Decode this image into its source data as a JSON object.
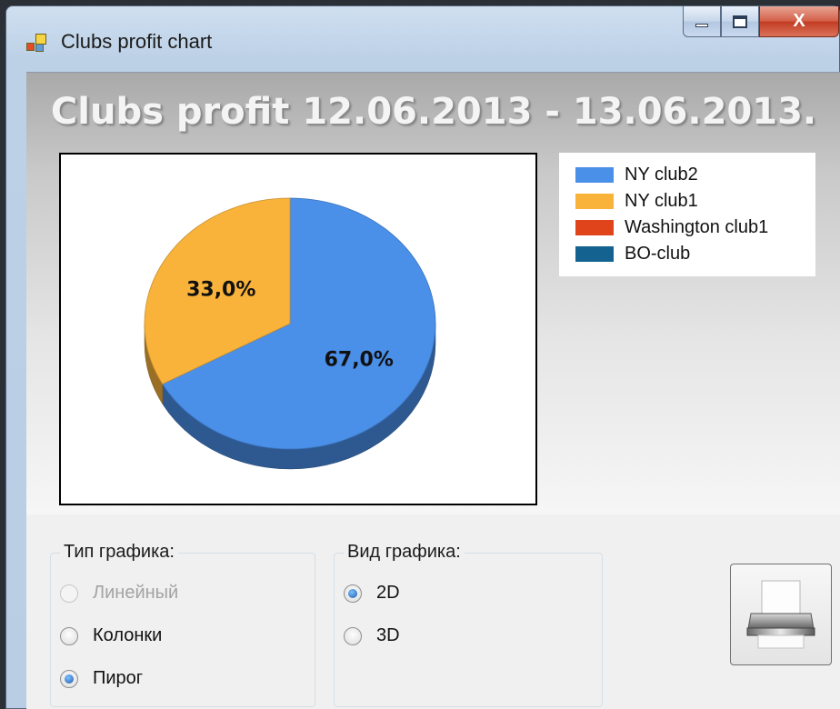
{
  "window": {
    "title": "Clubs profit chart",
    "icons": {
      "app": "app-window-icon",
      "minimize": "minimize-icon",
      "maximize": "maximize-icon",
      "close": "close-icon"
    },
    "close_glyph": "X"
  },
  "chart": {
    "title": "Clubs profit 12.06.2013 - 13.06.2013.",
    "legend": [
      {
        "label": "NY club2",
        "color": "#4a8fe8"
      },
      {
        "label": "NY club1",
        "color": "#f9b33b"
      },
      {
        "label": "Washington club1",
        "color": "#e0441a"
      },
      {
        "label": "BO-club",
        "color": "#13628f"
      }
    ]
  },
  "chart_data": {
    "type": "pie",
    "title": "Clubs profit 12.06.2013 - 13.06.2013.",
    "series": [
      {
        "name": "NY club2",
        "value": 67.0,
        "label": "67,0%",
        "color": "#4a8fe8"
      },
      {
        "name": "NY club1",
        "value": 33.0,
        "label": "33,0%",
        "color": "#f9b33b"
      },
      {
        "name": "Washington club1",
        "value": 0,
        "label": "",
        "color": "#e0441a"
      },
      {
        "name": "BO-club",
        "value": 0,
        "label": "",
        "color": "#13628f"
      }
    ],
    "style": "3D",
    "legend_position": "top-right"
  },
  "chart_type_group": {
    "legend": "Тип графика:",
    "options": [
      {
        "label": "Линейный",
        "checked": false,
        "disabled": true
      },
      {
        "label": "Колонки",
        "checked": false,
        "disabled": false
      },
      {
        "label": "Пирог",
        "checked": true,
        "disabled": false
      }
    ]
  },
  "chart_view_group": {
    "legend": "Вид графика:",
    "options": [
      {
        "label": "2D",
        "checked": true,
        "disabled": false
      },
      {
        "label": "3D",
        "checked": false,
        "disabled": false
      }
    ]
  },
  "print_button": {
    "icon": "printer-icon"
  }
}
